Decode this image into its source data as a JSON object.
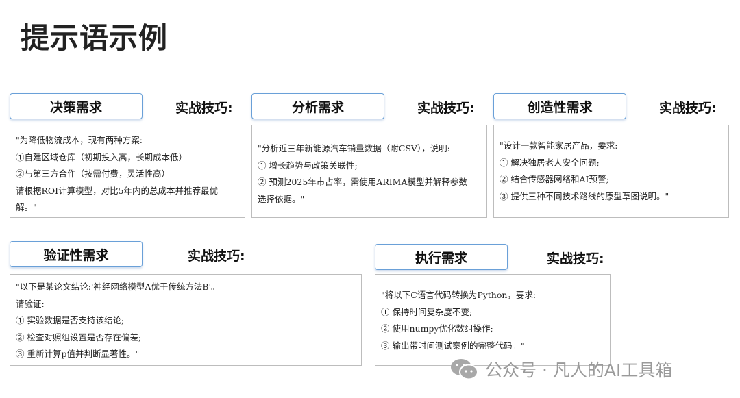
{
  "title": "提示语示例",
  "tips_label": "实战技巧:",
  "cards": [
    {
      "heading": "决策需求",
      "lines": [
        "\"为降低物流成本，现有两种方案:",
        "①自建区域仓库（初期投入高，长期成本低）",
        "②与第三方合作（按需付费，灵活性高）",
        "请根据ROI计算模型，对比5年内的总成本并推荐最优",
        "解。\""
      ]
    },
    {
      "heading": "分析需求",
      "lines": [
        "\"分析近三年新能源汽车销量数据（附CSV），说明:",
        "① 增长趋势与政策关联性;",
        "② 预测2025年市占率，需使用ARIMA模型并解释参数",
        "选择依据。\""
      ]
    },
    {
      "heading": "创造性需求",
      "lines": [
        "\"设计一款智能家居产品，要求:",
        "① 解决独居老人安全问题;",
        "② 结合传感器网络和AI预警;",
        "③ 提供三种不同技术路线的原型草图说明。\""
      ]
    },
    {
      "heading": "验证性需求",
      "lines": [
        "\"以下是某论文结论:'神经网络模型A优于传统方法B'。",
        "请验证:",
        "① 实验数据是否支持该结论;",
        "② 检查对照组设置是否存在偏差;",
        "③ 重新计算p值并判断显著性。\""
      ]
    },
    {
      "heading": "执行需求",
      "lines": [
        "\"将以下C语言代码转换为Python，要求:",
        "① 保持时间复杂度不变;",
        "② 使用numpy优化数组操作;",
        "③ 输出带时间测试案例的完整代码。\""
      ]
    }
  ],
  "watermark": {
    "icon": "wechat-icon",
    "text": "公众号 · 凡人的AI工具箱"
  }
}
